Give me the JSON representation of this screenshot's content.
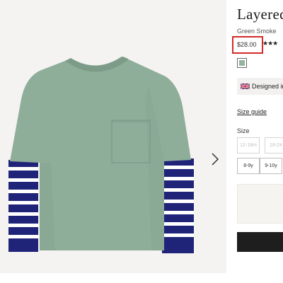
{
  "product": {
    "title": "Layered",
    "colour_name": "Green Smoke",
    "price": "$28.00",
    "rating_stars": "★★★",
    "swatch_color": "#92b39e",
    "designed_in": "Designed in",
    "size_guide": "Size guide",
    "size_label": "Size"
  },
  "sizes": [
    {
      "label": "12-18m",
      "available": false
    },
    {
      "label": "18-24",
      "available": false
    },
    {
      "label": "8-9y",
      "available": true
    },
    {
      "label": "9-10y",
      "available": true
    }
  ],
  "colors": {
    "highlight": "#d42a2a",
    "shirt": "#8fae9a",
    "stripe_navy": "#1f2478",
    "stripe_white": "#ffffff",
    "button_dark": "#1e1e1e"
  }
}
